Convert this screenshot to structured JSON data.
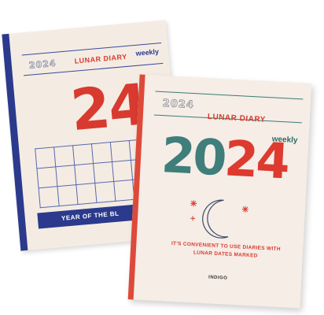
{
  "back_diary": {
    "year": "2024",
    "title": "LUNAR DIARY",
    "edition": "weekly",
    "big_number": "24",
    "band_text": "YEAR OF THE BL",
    "colors": {
      "cover": "#f4ece3",
      "accent": "#d83a2f",
      "spine": "#2b3a8c"
    }
  },
  "front_diary": {
    "year": "2024",
    "title": "LUNAR DIARY",
    "edition": "weekly",
    "big_year_part1": "20",
    "big_year_part2": "24",
    "slogan_line1": "IT'S CONVENIENT TO USE DIARIES WITH",
    "slogan_line2": "LUNAR DATES MARKED",
    "brand": "INDIGO",
    "colors": {
      "cover": "#f5ede6",
      "teal": "#3f7e7a",
      "red": "#dd3a30",
      "spine": "#dd4a3a"
    },
    "icons": [
      "crescent-moon-icon",
      "sparkle-star-icon"
    ]
  }
}
